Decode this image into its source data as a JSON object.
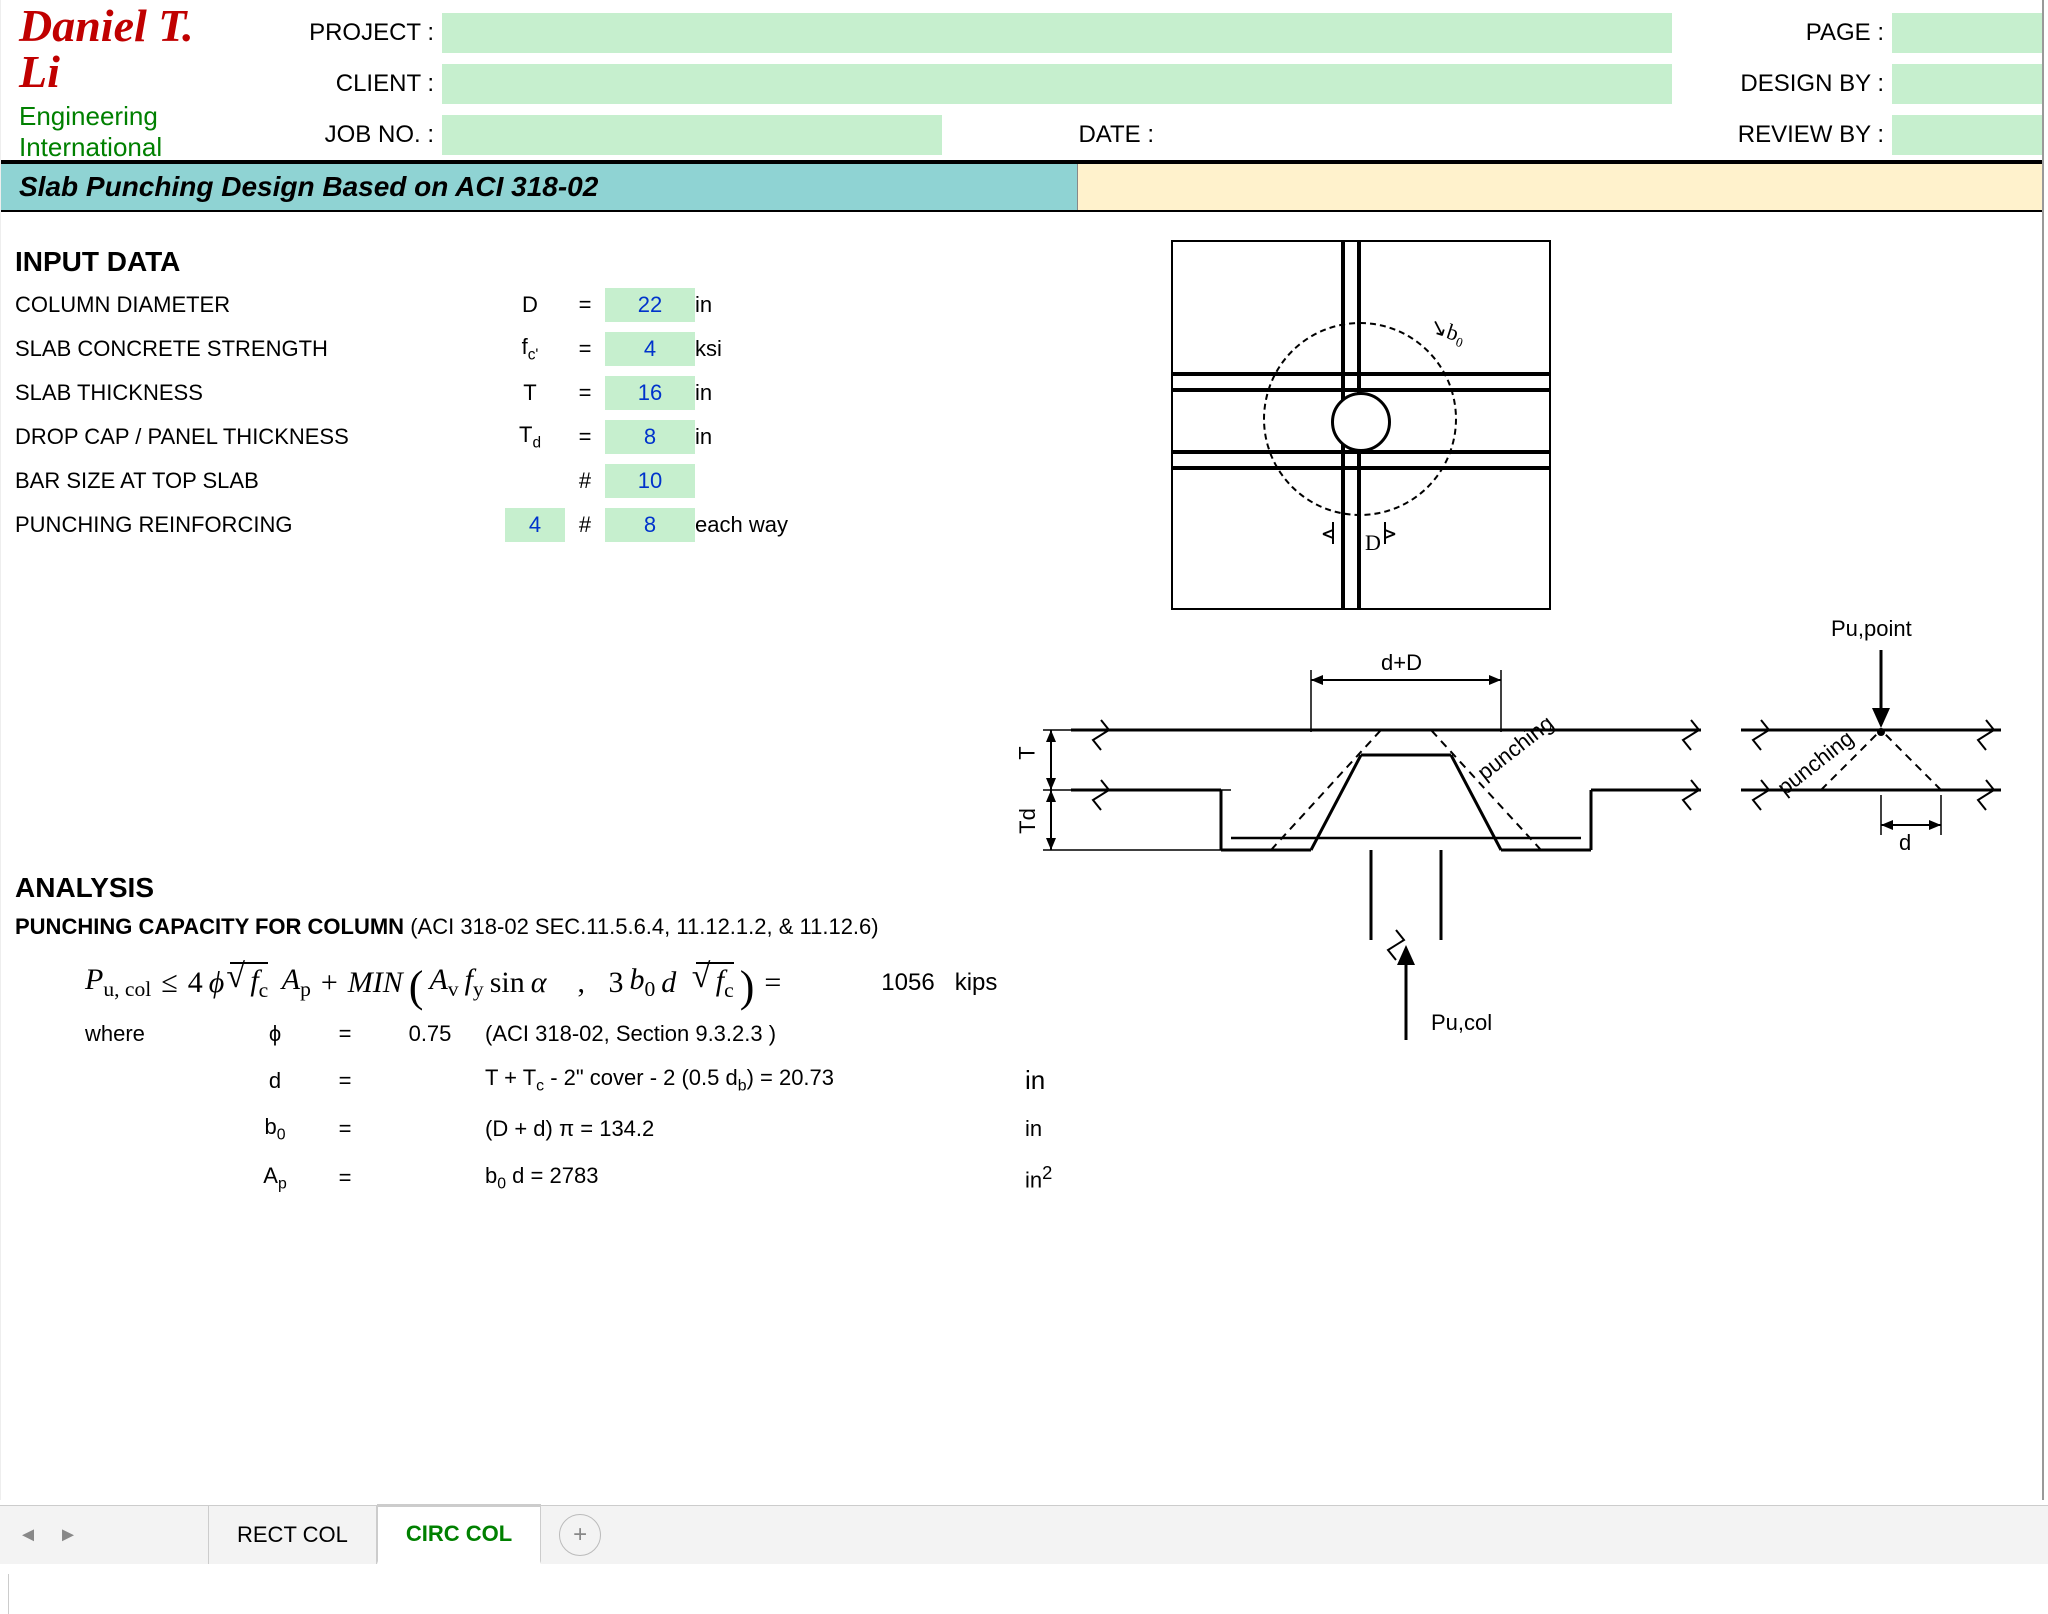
{
  "header": {
    "logo_name": "Daniel T. Li",
    "logo_sub": "Engineering International",
    "labels": {
      "project": "PROJECT :",
      "client": "CLIENT :",
      "jobno": "JOB NO. :",
      "date": "DATE :",
      "page": "PAGE :",
      "design_by": "DESIGN BY :",
      "review_by": "REVIEW BY :"
    },
    "values": {
      "project": "",
      "client": "",
      "jobno": "",
      "date": "",
      "page": "",
      "design_by": "",
      "review_by": ""
    }
  },
  "title": "Slab Punching Design Based on ACI 318-02",
  "sections": {
    "input": "INPUT DATA",
    "analysis": "ANALYSIS"
  },
  "input": {
    "rows": [
      {
        "label": "COLUMN DIAMETER",
        "sym": "D",
        "sub": "",
        "val": "22",
        "unit": "in"
      },
      {
        "label": "SLAB CONCRETE STRENGTH",
        "sym": "f",
        "sub": "c'",
        "val": "4",
        "unit": "ksi"
      },
      {
        "label": "SLAB THICKNESS",
        "sym": "T",
        "sub": "",
        "val": "16",
        "unit": "in"
      },
      {
        "label": "DROP CAP / PANEL THICKNESS",
        "sym": "T",
        "sub": "d",
        "val": "8",
        "unit": "in"
      },
      {
        "label": "BAR SIZE AT TOP SLAB",
        "sym": "",
        "sub": "",
        "val": "10",
        "unit": "",
        "hash": "#"
      },
      {
        "label": "PUNCHING REINFORCING",
        "pre_val": "4",
        "sym": "",
        "sub": "",
        "val": "8",
        "unit": "each way",
        "hash": "#"
      }
    ]
  },
  "analysis": {
    "sub_heading": "PUNCHING CAPACITY FOR COLUMN",
    "sub_note": "(ACI 318-02 SEC.11.5.6.4, 11.12.1.2, & 11.12.6)",
    "result_value": "1056",
    "result_unit": "kips",
    "formula_parts": {
      "lhs": "P",
      "lhs_sub": "u, col",
      "le": "≤",
      "coef": "4",
      "phi": "ϕ",
      "fc_sym": "f",
      "fc_sub": "c",
      "Ap_sym": "A",
      "Ap_sub": "p",
      "plus": "+",
      "min": "MIN",
      "Av_sym": "A",
      "Av_sub": "v",
      "fy_sym": "f",
      "fy_sub": "y",
      "sin": "sin",
      "alpha": "α",
      "comma": ",",
      "three": "3",
      "b0_sym": "b",
      "b0_sub": "0",
      "d_sym": "d",
      "eq": "="
    },
    "where_label": "where",
    "where": [
      {
        "sym_html": "ϕ",
        "eq": "=",
        "val": "0.75",
        "expr": "(ACI 318-02, Section 9.3.2.3 )",
        "unit": ""
      },
      {
        "sym_html": "d",
        "eq": "=",
        "val": "",
        "expr": "T + T<sub>c</sub> - 2\" cover - 2 (0.5 d<sub>b</sub>) =  20.73",
        "unit": "in"
      },
      {
        "sym_html": "b<sub>0</sub>",
        "eq": "=",
        "val": "",
        "expr": "(D + d) π =    134.2",
        "unit": "in"
      },
      {
        "sym_html": "A<sub>p</sub>",
        "eq": "=",
        "val": "",
        "expr": "b<sub>0</sub> d      =   2783",
        "unit": "in<sup>2</sup>"
      }
    ]
  },
  "diagram_labels": {
    "bo": "b₀",
    "D": "D",
    "dplusD": "d+D",
    "T": "T",
    "Td": "Td",
    "d": "d",
    "Pu_col": "Pu,col",
    "Pu_point": "Pu,point",
    "punching": "punching"
  },
  "tabs": {
    "rect": "RECT COL",
    "circ": "CIRC COL"
  }
}
